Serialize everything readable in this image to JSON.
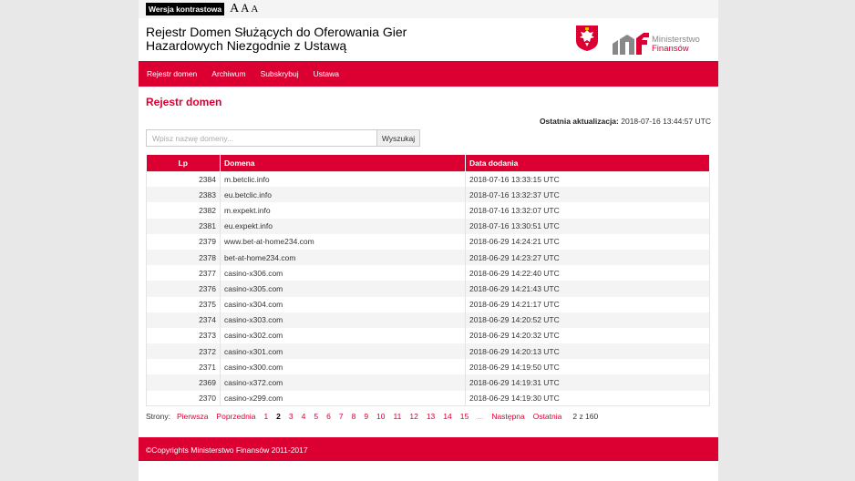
{
  "topbar": {
    "contrast_label": "Wersja kontrastowa",
    "font_sizes": [
      "A",
      "A",
      "A"
    ]
  },
  "header": {
    "title": "Rejestr Domen Służących do Oferowania Gier Hazardowych Niezgodnie z Ustawą",
    "mf_line1": "Ministerstwo",
    "mf_line2": "Finansów"
  },
  "nav": [
    "Rejestr domen",
    "Archiwum",
    "Subskrybuj",
    "Ustawa"
  ],
  "main": {
    "page_title": "Rejestr domen",
    "updated_label": "Ostatnia aktualizacja:",
    "updated_value": "2018-07-16 13:44:57 UTC",
    "search_placeholder": "Wpisz nazwę domeny...",
    "search_button": "Wyszukaj"
  },
  "table": {
    "headers": [
      "Lp",
      "Domena",
      "Data dodania"
    ],
    "rows": [
      [
        "2384",
        "m.betclic.info",
        "2018-07-16 13:33:15 UTC"
      ],
      [
        "2383",
        "eu.betclic.info",
        "2018-07-16 13:32:37 UTC"
      ],
      [
        "2382",
        "m.expekt.info",
        "2018-07-16 13:32:07 UTC"
      ],
      [
        "2381",
        "eu.expekt.info",
        "2018-07-16 13:30:51 UTC"
      ],
      [
        "2379",
        "www.bet-at-home234.com",
        "2018-06-29 14:24:21 UTC"
      ],
      [
        "2378",
        "bet-at-home234.com",
        "2018-06-29 14:23:27 UTC"
      ],
      [
        "2377",
        "casino-x306.com",
        "2018-06-29 14:22:40 UTC"
      ],
      [
        "2376",
        "casino-x305.com",
        "2018-06-29 14:21:43 UTC"
      ],
      [
        "2375",
        "casino-x304.com",
        "2018-06-29 14:21:17 UTC"
      ],
      [
        "2374",
        "casino-x303.com",
        "2018-06-29 14:20:52 UTC"
      ],
      [
        "2373",
        "casino-x302.com",
        "2018-06-29 14:20:32 UTC"
      ],
      [
        "2372",
        "casino-x301.com",
        "2018-06-29 14:20:13 UTC"
      ],
      [
        "2371",
        "casino-x300.com",
        "2018-06-29 14:19:50 UTC"
      ],
      [
        "2369",
        "casino-x372.com",
        "2018-06-29 14:19:31 UTC"
      ],
      [
        "2370",
        "casino-x299.com",
        "2018-06-29 14:19:30 UTC"
      ]
    ]
  },
  "pager": {
    "label": "Strony:",
    "first": "Pierwsza",
    "prev": "Poprzednia",
    "pages": [
      "1",
      "2",
      "3",
      "4",
      "5",
      "6",
      "7",
      "8",
      "9",
      "10",
      "11",
      "12",
      "13",
      "14",
      "15"
    ],
    "current": "2",
    "dots": "...",
    "next": "Następna",
    "last": "Ostatnia",
    "total": "2 z 160"
  },
  "footer": {
    "text": "©Copyrights Ministerstwo Finansów 2011-2017"
  },
  "colors": {
    "accent": "#dc0032",
    "background": "#e8e8e8"
  }
}
